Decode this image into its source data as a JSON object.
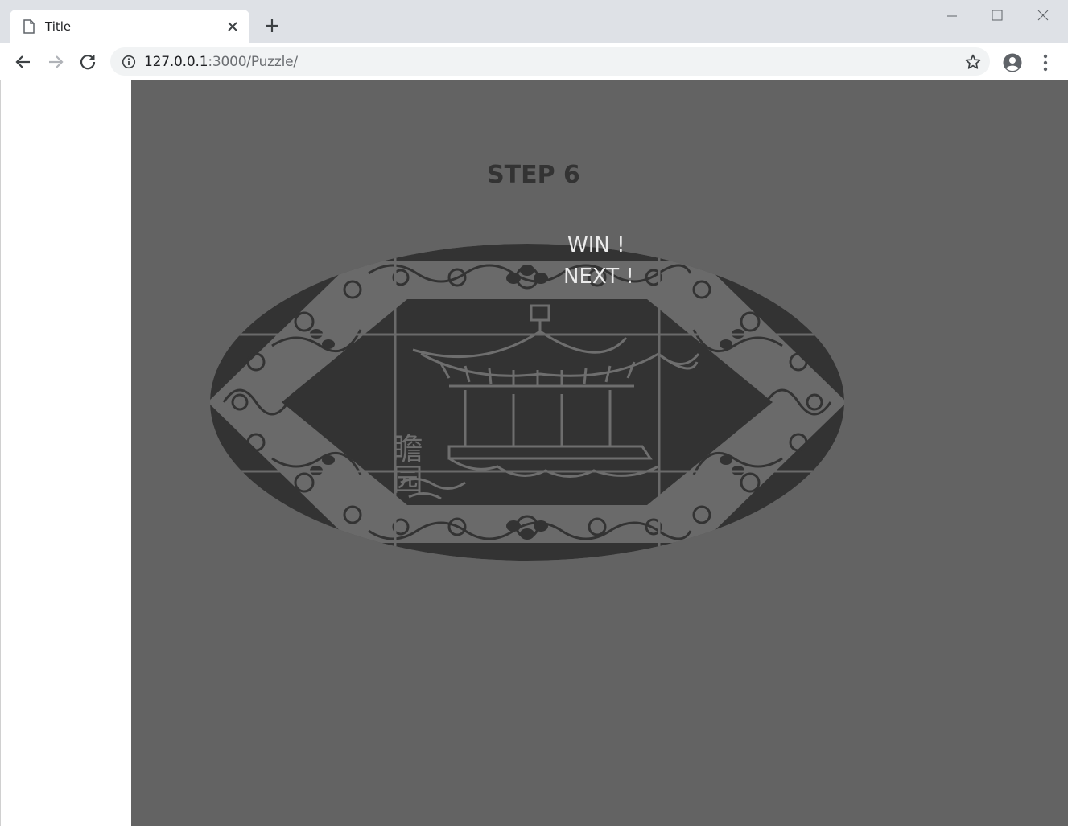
{
  "browser": {
    "tab_title": "Title",
    "url_host": "127.0.0.1",
    "url_path": ":3000/Puzzle/"
  },
  "game": {
    "step_label": "STEP 6",
    "win_label": "WIN !",
    "next_label": "NEXT !",
    "emblem_text": "瞻园",
    "grid": {
      "rows": 3,
      "cols": 3
    }
  },
  "colors": {
    "game_background": "#636363",
    "emblem_dark": "#333333",
    "emblem_pattern": "#6e6e6e"
  }
}
